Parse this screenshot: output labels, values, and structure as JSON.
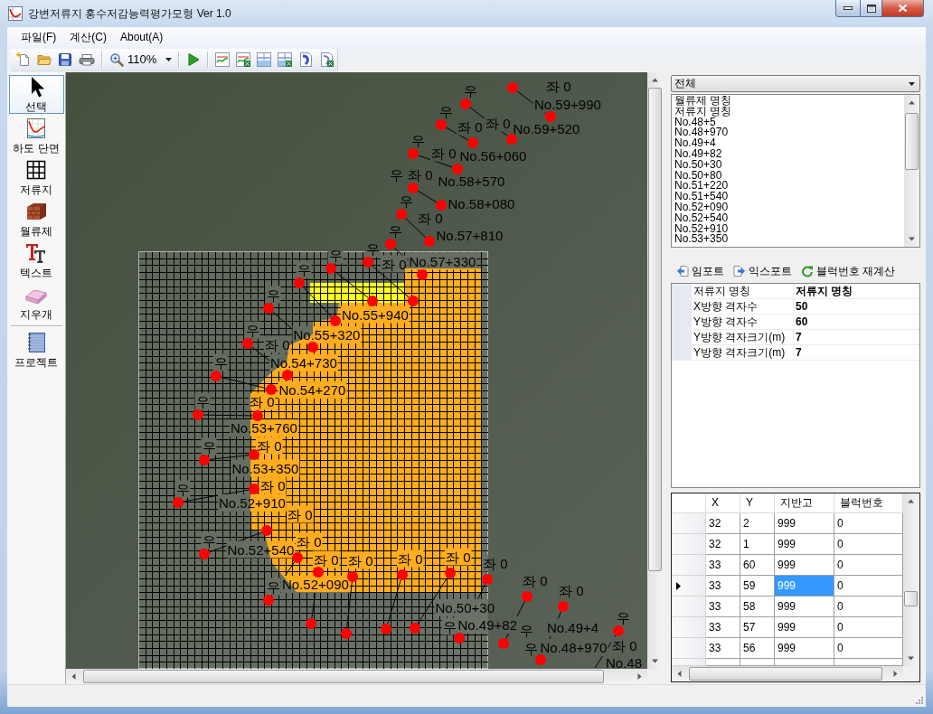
{
  "window": {
    "title": "강변저류지 홍수저감능력평가모형 Ver 1.0"
  },
  "menu": [
    "파일(F)",
    "계산(C)",
    "About(A)"
  ],
  "toolbar": {
    "zoom": "110%"
  },
  "toolbox": {
    "tools": [
      {
        "label": "선택",
        "selected": true
      },
      {
        "label": "하도 단면",
        "selected": false
      },
      {
        "label": "저류지",
        "selected": false
      },
      {
        "label": "월류제",
        "selected": false
      },
      {
        "label": "텍스트",
        "selected": false
      },
      {
        "label": "지우개",
        "selected": false
      }
    ],
    "project": {
      "label": "프로젝트"
    }
  },
  "map": {
    "cross_sections": [
      {
        "station": "No.59+990",
        "left_bank": "좌 0"
      },
      {
        "station": "No.59+520",
        "left_bank": "좌 0",
        "right_bank": "우"
      },
      {
        "station": "No.56+060",
        "left_bank": "좌 0",
        "right_bank": "우"
      },
      {
        "station": "No.58+570",
        "left_bank": "좌 0",
        "right_bank": "우"
      },
      {
        "station": "No.58+080",
        "left_bank": "좌 0",
        "right_bank": "우"
      },
      {
        "station": "No.57+810",
        "left_bank": "좌 0",
        "right_bank": "우"
      },
      {
        "right_bank": "우"
      },
      {
        "right_bank": "우"
      },
      {
        "station": "No.57+330",
        "left_bank": "좌 0",
        "right_bank": "우"
      },
      {
        "station": "No.55+940",
        "right_bank": "우"
      },
      {
        "station": "No.55+320",
        "right_bank": "우"
      },
      {
        "station": "No.54+730",
        "left_bank": "좌 0",
        "right_bank": "우"
      },
      {
        "station": "No.54+270",
        "right_bank": "우"
      },
      {
        "station": "No.53+760",
        "left_bank": "좌 0",
        "right_bank": "우"
      },
      {
        "station": "No.53+350",
        "left_bank": "좌 0",
        "right_bank": "우"
      },
      {
        "station": "No.52+910",
        "left_bank": "좌 0",
        "right_bank": "우"
      },
      {
        "station": "No.52+540",
        "left_bank": "좌 0",
        "right_bank": "우"
      },
      {
        "station": "No.52+090",
        "left_bank": "좌 0",
        "right_bank": "우"
      },
      {
        "left_bank": "좌 0"
      },
      {
        "left_bank": "좌 0"
      },
      {
        "left_bank": "좌 0"
      },
      {
        "station": "No.50+30",
        "left_bank": "좌 0"
      },
      {
        "station": "No.49+82",
        "left_bank": "좌 0",
        "right_bank": "우"
      },
      {
        "station": "No.49+4",
        "left_bank": "좌 0",
        "right_bank": "우"
      },
      {
        "station": "No.48+970",
        "left_bank": "좌 0",
        "right_bank": "우"
      },
      {
        "station": "No.48",
        "left_bank": "좌 0",
        "right_bank": "우"
      }
    ]
  },
  "side_panel": {
    "filter": "전체",
    "objects": [
      {
        "label": "월류제 명칭",
        "selected": false
      },
      {
        "label": "저류지 명칭",
        "selected": false
      },
      {
        "label": "No.48+5",
        "selected": false
      },
      {
        "label": "No.48+970",
        "selected": false
      },
      {
        "label": "No.49+4",
        "selected": false
      },
      {
        "label": "No.49+82",
        "selected": false
      },
      {
        "label": "No.50+30",
        "selected": false
      },
      {
        "label": "No.50+80",
        "selected": false
      },
      {
        "label": "No.51+220",
        "selected": false
      },
      {
        "label": "No.51+540",
        "selected": false
      },
      {
        "label": "No.52+090",
        "selected": false
      },
      {
        "label": "No.52+540",
        "selected": false
      },
      {
        "label": "No.52+910",
        "selected": false
      },
      {
        "label": "No.53+350",
        "selected": false
      }
    ],
    "actions": [
      "임포트",
      "익스포트",
      "블럭번호 재계산"
    ],
    "properties": [
      {
        "name": "저류지 명칭",
        "value": "저류지 명칭"
      },
      {
        "name": "X방향 격자수",
        "value": "50"
      },
      {
        "name": "Y방향 격자수",
        "value": "60"
      },
      {
        "name": "Y방향 격자크기(m)",
        "value": "7"
      },
      {
        "name": "Y방향 격자크기(m)",
        "value": "7"
      }
    ],
    "table": {
      "columns": [
        "X",
        "Y",
        "지반고",
        "블럭번호"
      ],
      "rows": [
        {
          "current": false,
          "cells": [
            {
              "text": "32",
              "selected": false
            },
            {
              "text": "2",
              "selected": false
            },
            {
              "text": "999",
              "selected": false
            },
            {
              "text": "0",
              "selected": false
            }
          ]
        },
        {
          "current": false,
          "cells": [
            {
              "text": "32",
              "selected": false
            },
            {
              "text": "1",
              "selected": false
            },
            {
              "text": "999",
              "selected": false
            },
            {
              "text": "0",
              "selected": false
            }
          ]
        },
        {
          "current": false,
          "cells": [
            {
              "text": "33",
              "selected": false
            },
            {
              "text": "60",
              "selected": false
            },
            {
              "text": "999",
              "selected": false
            },
            {
              "text": "0",
              "selected": false
            }
          ]
        },
        {
          "current": true,
          "cells": [
            {
              "text": "33",
              "selected": false
            },
            {
              "text": "59",
              "selected": false
            },
            {
              "text": "999",
              "selected": true
            },
            {
              "text": "0",
              "selected": false
            }
          ]
        },
        {
          "current": false,
          "cells": [
            {
              "text": "33",
              "selected": false
            },
            {
              "text": "58",
              "selected": false
            },
            {
              "text": "999",
              "selected": false
            },
            {
              "text": "0",
              "selected": false
            }
          ]
        },
        {
          "current": false,
          "cells": [
            {
              "text": "33",
              "selected": false
            },
            {
              "text": "57",
              "selected": false
            },
            {
              "text": "999",
              "selected": false
            },
            {
              "text": "0",
              "selected": false
            }
          ]
        },
        {
          "current": false,
          "cells": [
            {
              "text": "33",
              "selected": false
            },
            {
              "text": "56",
              "selected": false
            },
            {
              "text": "999",
              "selected": false
            },
            {
              "text": "0",
              "selected": false
            }
          ]
        }
      ]
    }
  }
}
